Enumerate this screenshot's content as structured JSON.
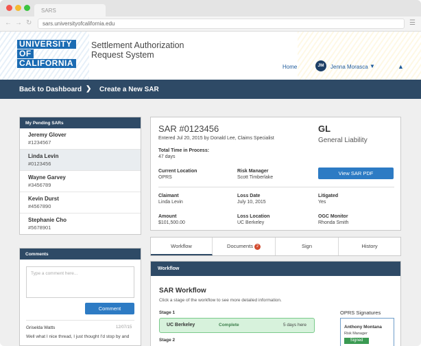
{
  "browser": {
    "tab_title": "SARS",
    "url": "sars.universityofcalifornia.edu"
  },
  "header": {
    "logo_lines": [
      "UNIVERSITY",
      "OF",
      "CALIFORNIA"
    ],
    "app_title_line1": "Settlement Authorization",
    "app_title_line2": "Request System",
    "home_label": "Home",
    "avatar_initials": "JM",
    "user_name": "Jenna Morasca"
  },
  "breadcrumb": {
    "back": "Back to Dashboard",
    "current": "Create a New SAR"
  },
  "pending": {
    "title": "My Pending SARs",
    "items": [
      {
        "name": "Jeremy Glover",
        "number": "#1234567"
      },
      {
        "name": "Linda Levin",
        "number": "#0123456"
      },
      {
        "name": "Wayne Garvey",
        "number": "#3456789"
      },
      {
        "name": "Kevin Durst",
        "number": "#4567890"
      },
      {
        "name": "Stephanie Cho",
        "number": "#5678901"
      }
    ]
  },
  "comments": {
    "title": "Comments",
    "placeholder": "Type a comment here...",
    "button": "Comment",
    "entries": [
      {
        "author": "Griselda Watts",
        "date": "12/07/15",
        "text": "Well what I nice thread, I just thought I'd stop by and"
      }
    ]
  },
  "sar": {
    "number": "SAR #0123456",
    "entered": "Entered Jul 20, 2015 by Donald Lee, Claims Specialist",
    "code": "GL",
    "code_name": "General Liability",
    "pdf_button": "View SAR PDF",
    "time_label": "Total Time in Process:",
    "time_value": "47 days",
    "current_location_label": "Current Location",
    "current_location_value": "OPRS",
    "risk_manager_label": "Risk Manager",
    "risk_manager_value": "Scott Timberlake",
    "claimant_label": "Claimant",
    "claimant_value": "Linda Levin",
    "loss_date_label": "Loss Date",
    "loss_date_value": "July 10, 2015",
    "litigated_label": "Litigated",
    "litigated_value": "Yes",
    "amount_label": "Amount",
    "amount_value": "$101,500.00",
    "loss_location_label": "Loss Location",
    "loss_location_value": "UC Berkeley",
    "ogc_label": "OGC Monitor",
    "ogc_value": "Rhonda Smith"
  },
  "tabs": {
    "workflow": "Workflow",
    "documents": "Documents",
    "documents_badge": "2",
    "sign": "Sign",
    "history": "History"
  },
  "workflow": {
    "panel_title": "Workflow",
    "title": "SAR Workflow",
    "subtitle": "Click a stage of the workflow to see more detailed information.",
    "stage1_label": "Stage 1",
    "stage1_name": "UC Berkeley",
    "stage1_status": "Complete",
    "stage1_time": "5 days here",
    "stage2_label": "Stage 2",
    "signatures_title": "OPRS Signatures",
    "signer_name": "Anthony Montana",
    "signer_role": "Risk Manager",
    "signer_status": "Signed"
  }
}
